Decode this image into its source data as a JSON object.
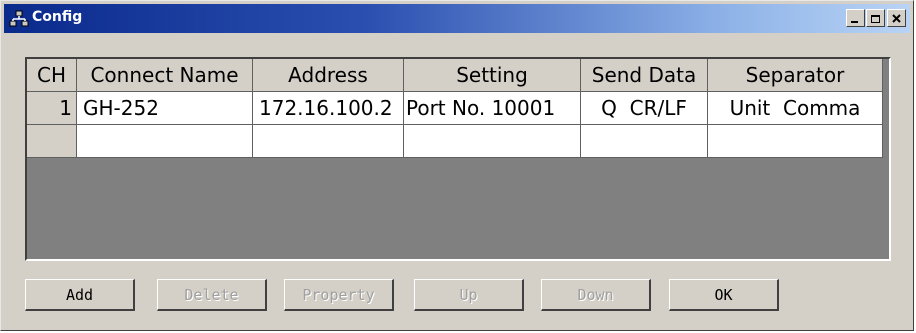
{
  "window": {
    "title": "Config",
    "icon": "network-icon",
    "controls": [
      "minimize-icon",
      "maximize-icon",
      "close-icon"
    ]
  },
  "table": {
    "headers": [
      "CH",
      "Connect Name",
      "Address",
      "Setting",
      "Send Data",
      "Separator"
    ],
    "rows": [
      [
        "1",
        "GH-252",
        "172.16.100.2",
        "Port No. 10001",
        "Q  CR/LF",
        "Unit  Comma"
      ]
    ]
  },
  "buttons": {
    "add": "Add",
    "delete": "Delete",
    "property": "Property",
    "up": "Up",
    "down": "Down",
    "ok": "OK"
  },
  "colors": {
    "title_start": "#0a2a8c",
    "title_end": "#b9d3f4",
    "face": "#d4d0c8",
    "grid_bg": "#808080"
  }
}
